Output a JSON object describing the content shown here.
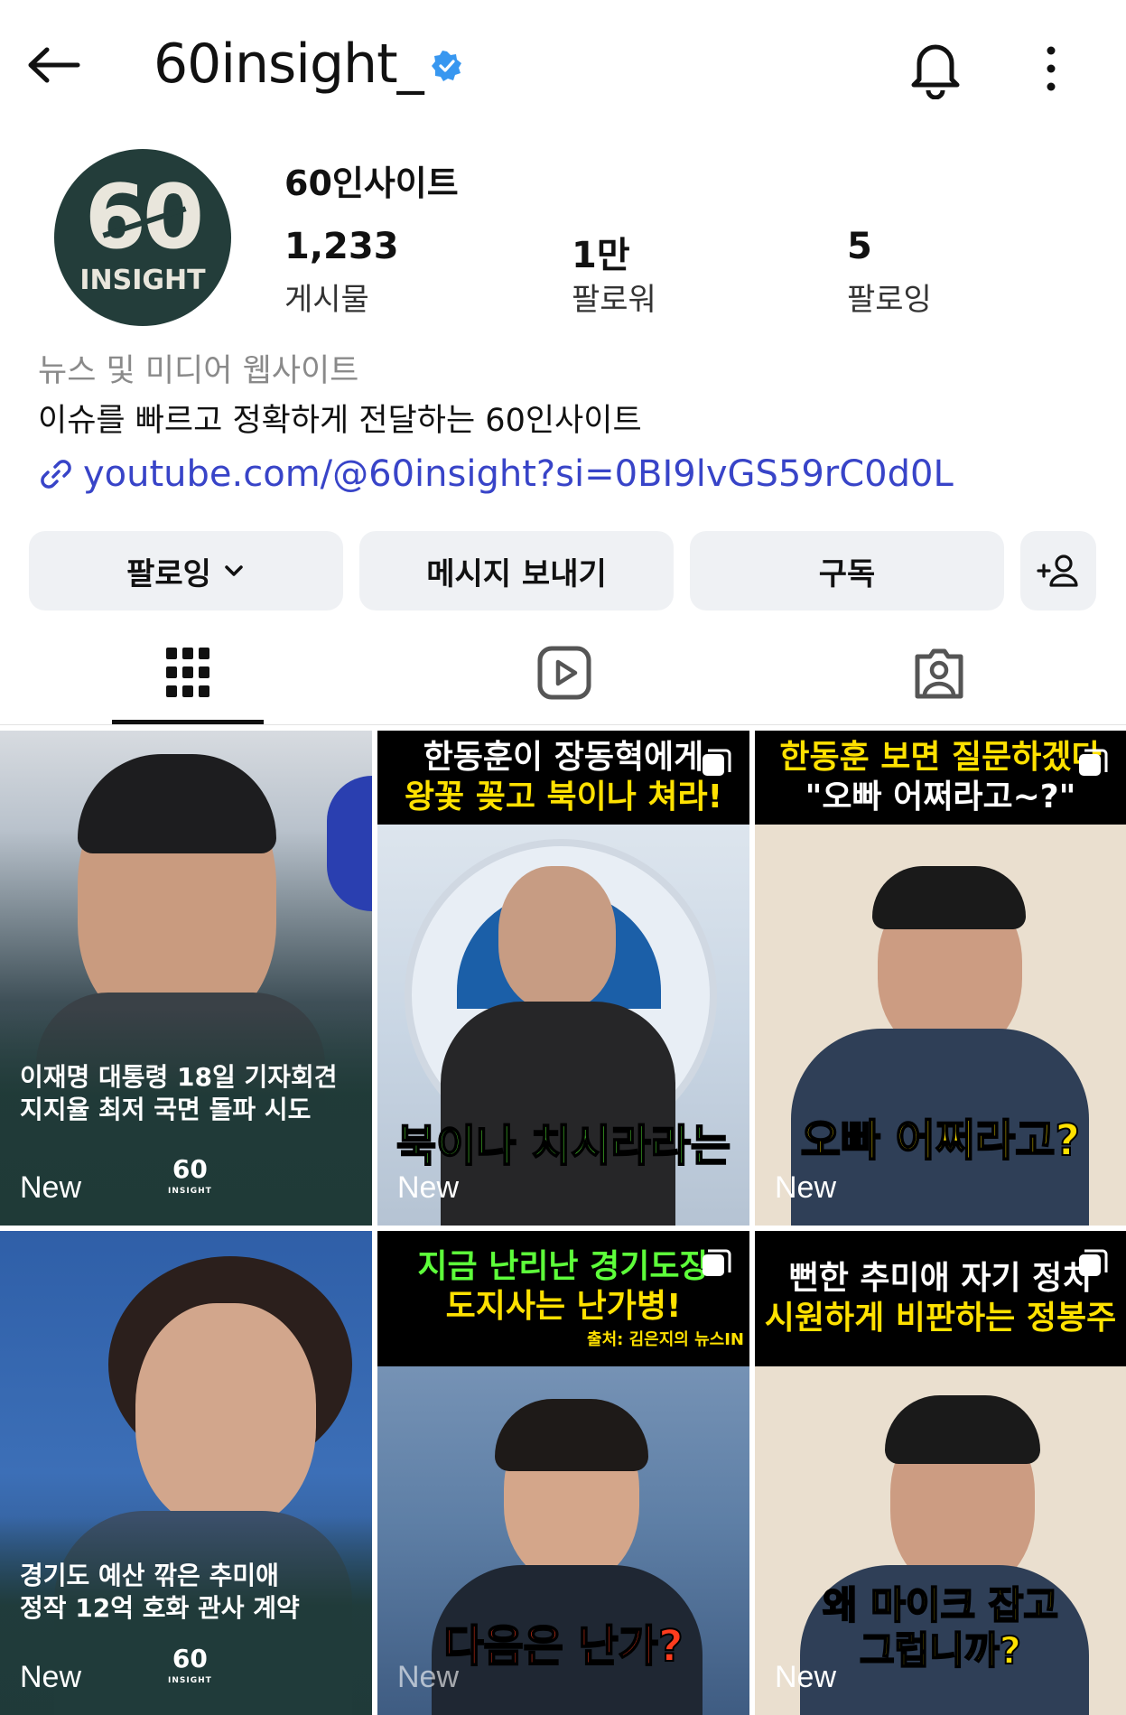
{
  "header": {
    "username": "60insight_"
  },
  "profile": {
    "avatar_text": "60",
    "avatar_subtext": "INSIGHT",
    "display_name": "60인사이트",
    "stats": [
      {
        "value": "1,233",
        "label": "게시물"
      },
      {
        "value": "1만",
        "label": "팔로워"
      },
      {
        "value": "5",
        "label": "팔로잉"
      }
    ],
    "category": "뉴스 및 미디어 웹사이트",
    "bio": "이슈를 빠르고 정확하게 전달하는 60인사이트",
    "link": "youtube.com/@60insight?si=0BI9lvGS59rC0d0L"
  },
  "actions": {
    "following": "팔로잉",
    "message": "메시지 보내기",
    "subscribe": "구독"
  },
  "colors": {
    "link": "#3844c8",
    "verified": "#3897f0",
    "button_bg": "#eff1f4"
  },
  "posts": [
    {
      "badge": "New",
      "lines": [
        "이재명 대통령 18일 기자회견",
        "지지율 최저 국면 돌파 시도"
      ],
      "logo": "60",
      "logo_sub": "INSIGHT"
    },
    {
      "badge": "New",
      "caption": [
        "한동훈이 장동혁에게",
        "왕꽃 꽂고 북이나 쳐라!"
      ],
      "subtitle": "북이나 치시라라는"
    },
    {
      "badge": "New",
      "caption": [
        "한동훈 보면 질문하겠다",
        "\"오빠 어쩌라고~?\""
      ],
      "subtitle": "오빠 어쩌라고?"
    },
    {
      "badge": "New",
      "lines": [
        "경기도 예산 깎은 추미애",
        "정작 12억 호화 관사 계약"
      ],
      "logo": "60",
      "logo_sub": "INSIGHT"
    },
    {
      "badge": "New",
      "caption": [
        "지금 난리난 경기도장",
        "도지사는 난가병!"
      ],
      "source": "출처: 김은지의 뉴스IN",
      "subtitle": "다음은 난가?"
    },
    {
      "badge": "New",
      "caption": [
        "뻔한 추미애 자기 정치",
        "시원하게 비판하는 정봉주"
      ],
      "subtitle": "왜 마이크 잡고 그럽니까?"
    }
  ]
}
